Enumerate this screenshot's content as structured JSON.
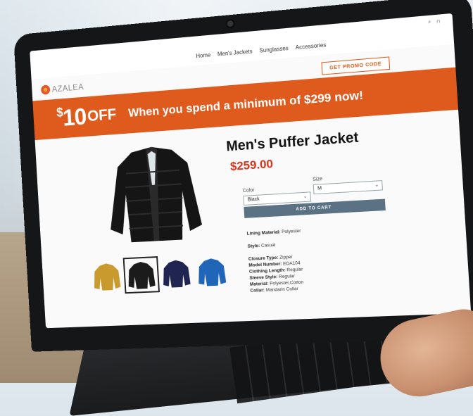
{
  "site": {
    "logo": "AZALEA",
    "nav": [
      "Home",
      "Men's Jackets",
      "Sunglasses",
      "Accessories"
    ],
    "utility_icons": [
      "search-icon",
      "bag-icon"
    ]
  },
  "banner": {
    "currency": "$",
    "amount": "10",
    "off": "OFF",
    "text": "When you spend a minimum of $299 now!",
    "button": "GET PROMO CODE",
    "color": "#df5b1d"
  },
  "product": {
    "title": "Men's Puffer Jacket",
    "price": "$259.00",
    "color_label": "Color",
    "color_value": "Black",
    "size_label": "Size",
    "size_value": "M",
    "add_to_cart": "ADD TO CART",
    "lining_label": "Lining Material:",
    "lining_value": "Polyester",
    "style_label": "Style:",
    "style_value": "Casual",
    "specs": [
      {
        "label": "Closure Type:",
        "value": "Zipper"
      },
      {
        "label": "Model Number:",
        "value": "EDA104"
      },
      {
        "label": "Clothing Length:",
        "value": "Regular"
      },
      {
        "label": "Sleeve Style:",
        "value": "Regular"
      },
      {
        "label": "Material:",
        "value": "Polyester,Cotton"
      },
      {
        "label": "Collar:",
        "value": "Mandarin Collar"
      }
    ],
    "thumbnail_colors": [
      "#c99a2e",
      "#1b1b1b",
      "#1f2550",
      "#1f66b8"
    ]
  }
}
